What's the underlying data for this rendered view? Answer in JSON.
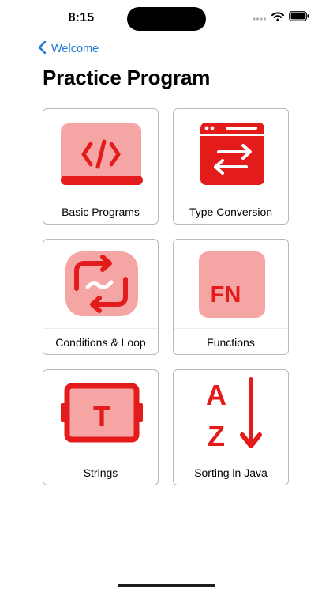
{
  "status_bar": {
    "time": "8:15",
    "icons": [
      "signal-dots-icon",
      "wifi-icon",
      "battery-icon"
    ]
  },
  "nav": {
    "back_label": "Welcome",
    "back_icon": "chevron-left-icon"
  },
  "page_title": "Practice Program",
  "colors": {
    "accent_red": "#e31b1b",
    "light_red": "#f6a5a5",
    "link_blue": "#1f78d1"
  },
  "cards": [
    {
      "label": "Basic Programs",
      "icon": "code-laptop-icon"
    },
    {
      "label": "Type Conversion",
      "icon": "swap-window-icon"
    },
    {
      "label": "Conditions & Loop",
      "icon": "loop-icon"
    },
    {
      "label": "Functions",
      "icon": "function-fn-icon",
      "icon_text": "FN"
    },
    {
      "label": "Strings",
      "icon": "text-t-icon",
      "icon_text": "T"
    },
    {
      "label": "Sorting in Java",
      "icon": "sort-a-z-icon",
      "icon_text_top": "A",
      "icon_text_bottom": "Z"
    }
  ]
}
